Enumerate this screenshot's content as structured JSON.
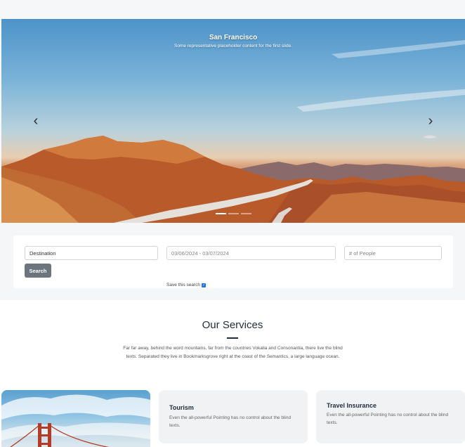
{
  "carousel": {
    "slide_title": "San Francisco",
    "slide_caption": "Some representative placeholder content for the first slide.",
    "prev_icon": "‹",
    "next_icon": "›",
    "indicator_count": 3,
    "active_indicator": 1
  },
  "search": {
    "destination_placeholder": "Destination",
    "dates_value": "03/06/2024 - 03/07/2024",
    "people_placeholder": "# of People",
    "search_button": "Search",
    "save_label": "Save this search",
    "save_checked": true
  },
  "services": {
    "title": "Our Services",
    "description": "Far far away, behind the word mountains, far from the countries Vokalia and Consonantia, there live the blind texts. Separated they live in Bookmarksgrove right at the coast of the Semantics, a large language ocean.",
    "cards": [
      {
        "title": "Tourism",
        "text": "Even the all-powerful Pointing has no control about the blind texts."
      },
      {
        "title": "Travel Insurance",
        "text": "Even the all-powerful Pointing has no control about the blind texts."
      }
    ]
  },
  "colors": {
    "accent": "#1f2d3d",
    "button": "#6c757d",
    "checkbox": "#1a73e8"
  }
}
